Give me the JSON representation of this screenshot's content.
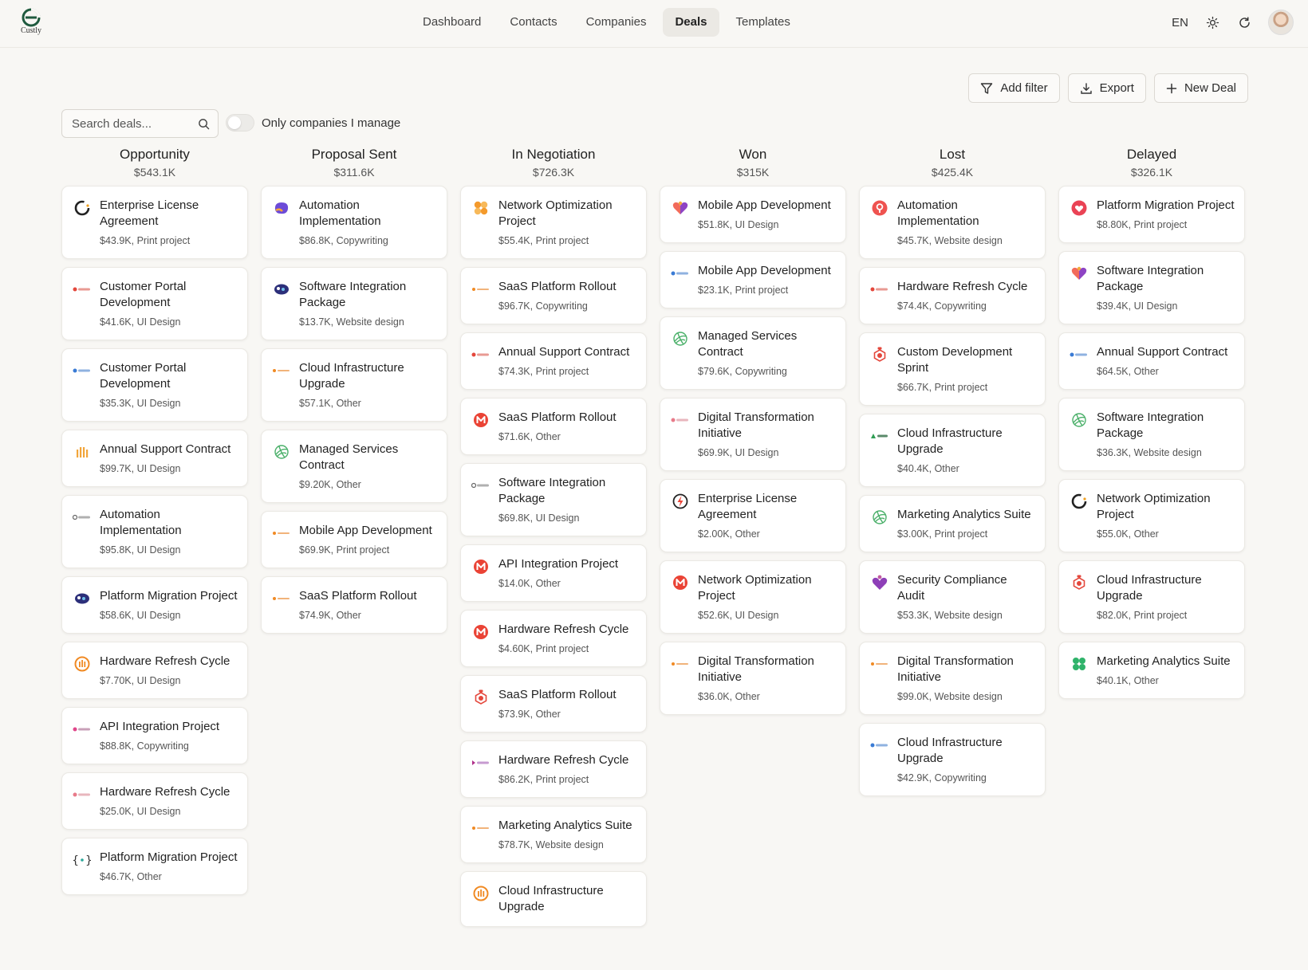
{
  "brand": {
    "name": "Custly",
    "color": "#1f5a3e"
  },
  "nav": {
    "items": [
      {
        "label": "Dashboard",
        "active": false
      },
      {
        "label": "Contacts",
        "active": false
      },
      {
        "label": "Companies",
        "active": false
      },
      {
        "label": "Deals",
        "active": true
      },
      {
        "label": "Templates",
        "active": false
      }
    ]
  },
  "header": {
    "language": "EN",
    "theme_icon": "sun-icon",
    "refresh_icon": "refresh-icon"
  },
  "actions": {
    "add_filter": "Add filter",
    "export": "Export",
    "new_deal": "New Deal"
  },
  "filters": {
    "search_placeholder": "Search deals...",
    "toggle_label": "Only companies I manage",
    "toggle_on": false
  },
  "columns": [
    {
      "title": "Opportunity",
      "total": "$543.1K",
      "cards": [
        {
          "name": "Enterprise License Agreement",
          "meta": "$43.9K, Print project",
          "logo": "ring-dark"
        },
        {
          "name": "Customer Portal Development",
          "meta": "$41.6K, UI Design",
          "logo": "wordmark-red"
        },
        {
          "name": "Customer Portal Development",
          "meta": "$35.3K, UI Design",
          "logo": "wordmark-blue"
        },
        {
          "name": "Annual Support Contract",
          "meta": "$99.7K, UI Design",
          "logo": "bars-orange"
        },
        {
          "name": "Automation Implementation",
          "meta": "$95.8K, UI Design",
          "logo": "wordmark-gray"
        },
        {
          "name": "Platform Migration Project",
          "meta": "$58.6K, UI Design",
          "logo": "blob-navy"
        },
        {
          "name": "Hardware Refresh Cycle",
          "meta": "$7.70K, UI Design",
          "logo": "circle-orange"
        },
        {
          "name": "API Integration Project",
          "meta": "$88.8K, Copywriting",
          "logo": "wordmark-pink"
        },
        {
          "name": "Hardware Refresh Cycle",
          "meta": "$25.0K, UI Design",
          "logo": "wordmark-rose"
        },
        {
          "name": "Platform Migration Project",
          "meta": "$46.7K, Other",
          "logo": "braces-teal"
        }
      ]
    },
    {
      "title": "Proposal Sent",
      "total": "$311.6K",
      "cards": [
        {
          "name": "Automation Implementation",
          "meta": "$86.8K, Copywriting",
          "logo": "blob-purple"
        },
        {
          "name": "Software Integration Package",
          "meta": "$13.7K, Website design",
          "logo": "blob-navy"
        },
        {
          "name": "Cloud Infrastructure Upgrade",
          "meta": "$57.1K, Other",
          "logo": "wordmark-orange"
        },
        {
          "name": "Managed Services Contract",
          "meta": "$9.20K, Other",
          "logo": "leaf-green"
        },
        {
          "name": "Mobile App Development",
          "meta": "$69.9K, Print project",
          "logo": "wordmark-orange"
        },
        {
          "name": "SaaS Platform Rollout",
          "meta": "$74.9K, Other",
          "logo": "wordmark-orange"
        }
      ]
    },
    {
      "title": "In Negotiation",
      "total": "$726.3K",
      "cards": [
        {
          "name": "Network Optimization Project",
          "meta": "$55.4K, Print project",
          "logo": "flower-orange"
        },
        {
          "name": "SaaS Platform Rollout",
          "meta": "$96.7K, Copywriting",
          "logo": "wordmark-orange"
        },
        {
          "name": "Annual Support Contract",
          "meta": "$74.3K, Print project",
          "logo": "wordmark-red"
        },
        {
          "name": "SaaS Platform Rollout",
          "meta": "$71.6K, Other",
          "logo": "badge-red"
        },
        {
          "name": "Software Integration Package",
          "meta": "$69.8K, UI Design",
          "logo": "wordmark-gray"
        },
        {
          "name": "API Integration Project",
          "meta": "$14.0K, Other",
          "logo": "badge-red"
        },
        {
          "name": "Hardware Refresh Cycle",
          "meta": "$4.60K, Print project",
          "logo": "badge-red"
        },
        {
          "name": "SaaS Platform Rollout",
          "meta": "$73.9K, Other",
          "logo": "hex-red"
        },
        {
          "name": "Hardware Refresh Cycle",
          "meta": "$86.2K, Print project",
          "logo": "wordmark-purple"
        },
        {
          "name": "Marketing Analytics Suite",
          "meta": "$78.7K, Website design",
          "logo": "wordmark-orange"
        },
        {
          "name": "Cloud Infrastructure Upgrade",
          "meta": "",
          "logo": "circle-orange"
        }
      ]
    },
    {
      "title": "Won",
      "total": "$315K",
      "cards": [
        {
          "name": "Mobile App Development",
          "meta": "$51.8K, UI Design",
          "logo": "heart-multi"
        },
        {
          "name": "Mobile App Development",
          "meta": "$23.1K, Print project",
          "logo": "wordmark-blue"
        },
        {
          "name": "Managed Services Contract",
          "meta": "$79.6K, Copywriting",
          "logo": "leaf-green"
        },
        {
          "name": "Digital Transformation Initiative",
          "meta": "$69.9K, UI Design",
          "logo": "wordmark-rose"
        },
        {
          "name": "Enterprise License Agreement",
          "meta": "$2.00K, Other",
          "logo": "bolt-red"
        },
        {
          "name": "Network Optimization Project",
          "meta": "$52.6K, UI Design",
          "logo": "badge-red"
        },
        {
          "name": "Digital Transformation Initiative",
          "meta": "$36.0K, Other",
          "logo": "wordmark-orange"
        }
      ]
    },
    {
      "title": "Lost",
      "total": "$425.4K",
      "cards": [
        {
          "name": "Automation Implementation",
          "meta": "$45.7K, Website design",
          "logo": "pin-red"
        },
        {
          "name": "Hardware Refresh Cycle",
          "meta": "$74.4K, Copywriting",
          "logo": "wordmark-red"
        },
        {
          "name": "Custom Development Sprint",
          "meta": "$66.7K, Print project",
          "logo": "hex-red"
        },
        {
          "name": "Cloud Infrastructure Upgrade",
          "meta": "$40.4K, Other",
          "logo": "wordmark-green"
        },
        {
          "name": "Marketing Analytics Suite",
          "meta": "$3.00K, Print project",
          "logo": "leaf-green"
        },
        {
          "name": "Security Compliance Audit",
          "meta": "$53.3K, Website design",
          "logo": "heart-purple"
        },
        {
          "name": "Digital Transformation Initiative",
          "meta": "$99.0K, Website design",
          "logo": "wordmark-orange"
        },
        {
          "name": "Cloud Infrastructure Upgrade",
          "meta": "$42.9K, Copywriting",
          "logo": "wordmark-blue"
        }
      ]
    },
    {
      "title": "Delayed",
      "total": "$326.1K",
      "cards": [
        {
          "name": "Platform Migration Project",
          "meta": "$8.80K, Print project",
          "logo": "heart-red"
        },
        {
          "name": "Software Integration Package",
          "meta": "$39.4K, UI Design",
          "logo": "heart-multi"
        },
        {
          "name": "Annual Support Contract",
          "meta": "$64.5K, Other",
          "logo": "wordmark-blue"
        },
        {
          "name": "Software Integration Package",
          "meta": "$36.3K, Website design",
          "logo": "leaf-green"
        },
        {
          "name": "Network Optimization Project",
          "meta": "$55.0K, Other",
          "logo": "ring-dark"
        },
        {
          "name": "Cloud Infrastructure Upgrade",
          "meta": "$82.0K, Print project",
          "logo": "hex-red"
        },
        {
          "name": "Marketing Analytics Suite",
          "meta": "$40.1K, Other",
          "logo": "clover-green"
        }
      ]
    }
  ]
}
